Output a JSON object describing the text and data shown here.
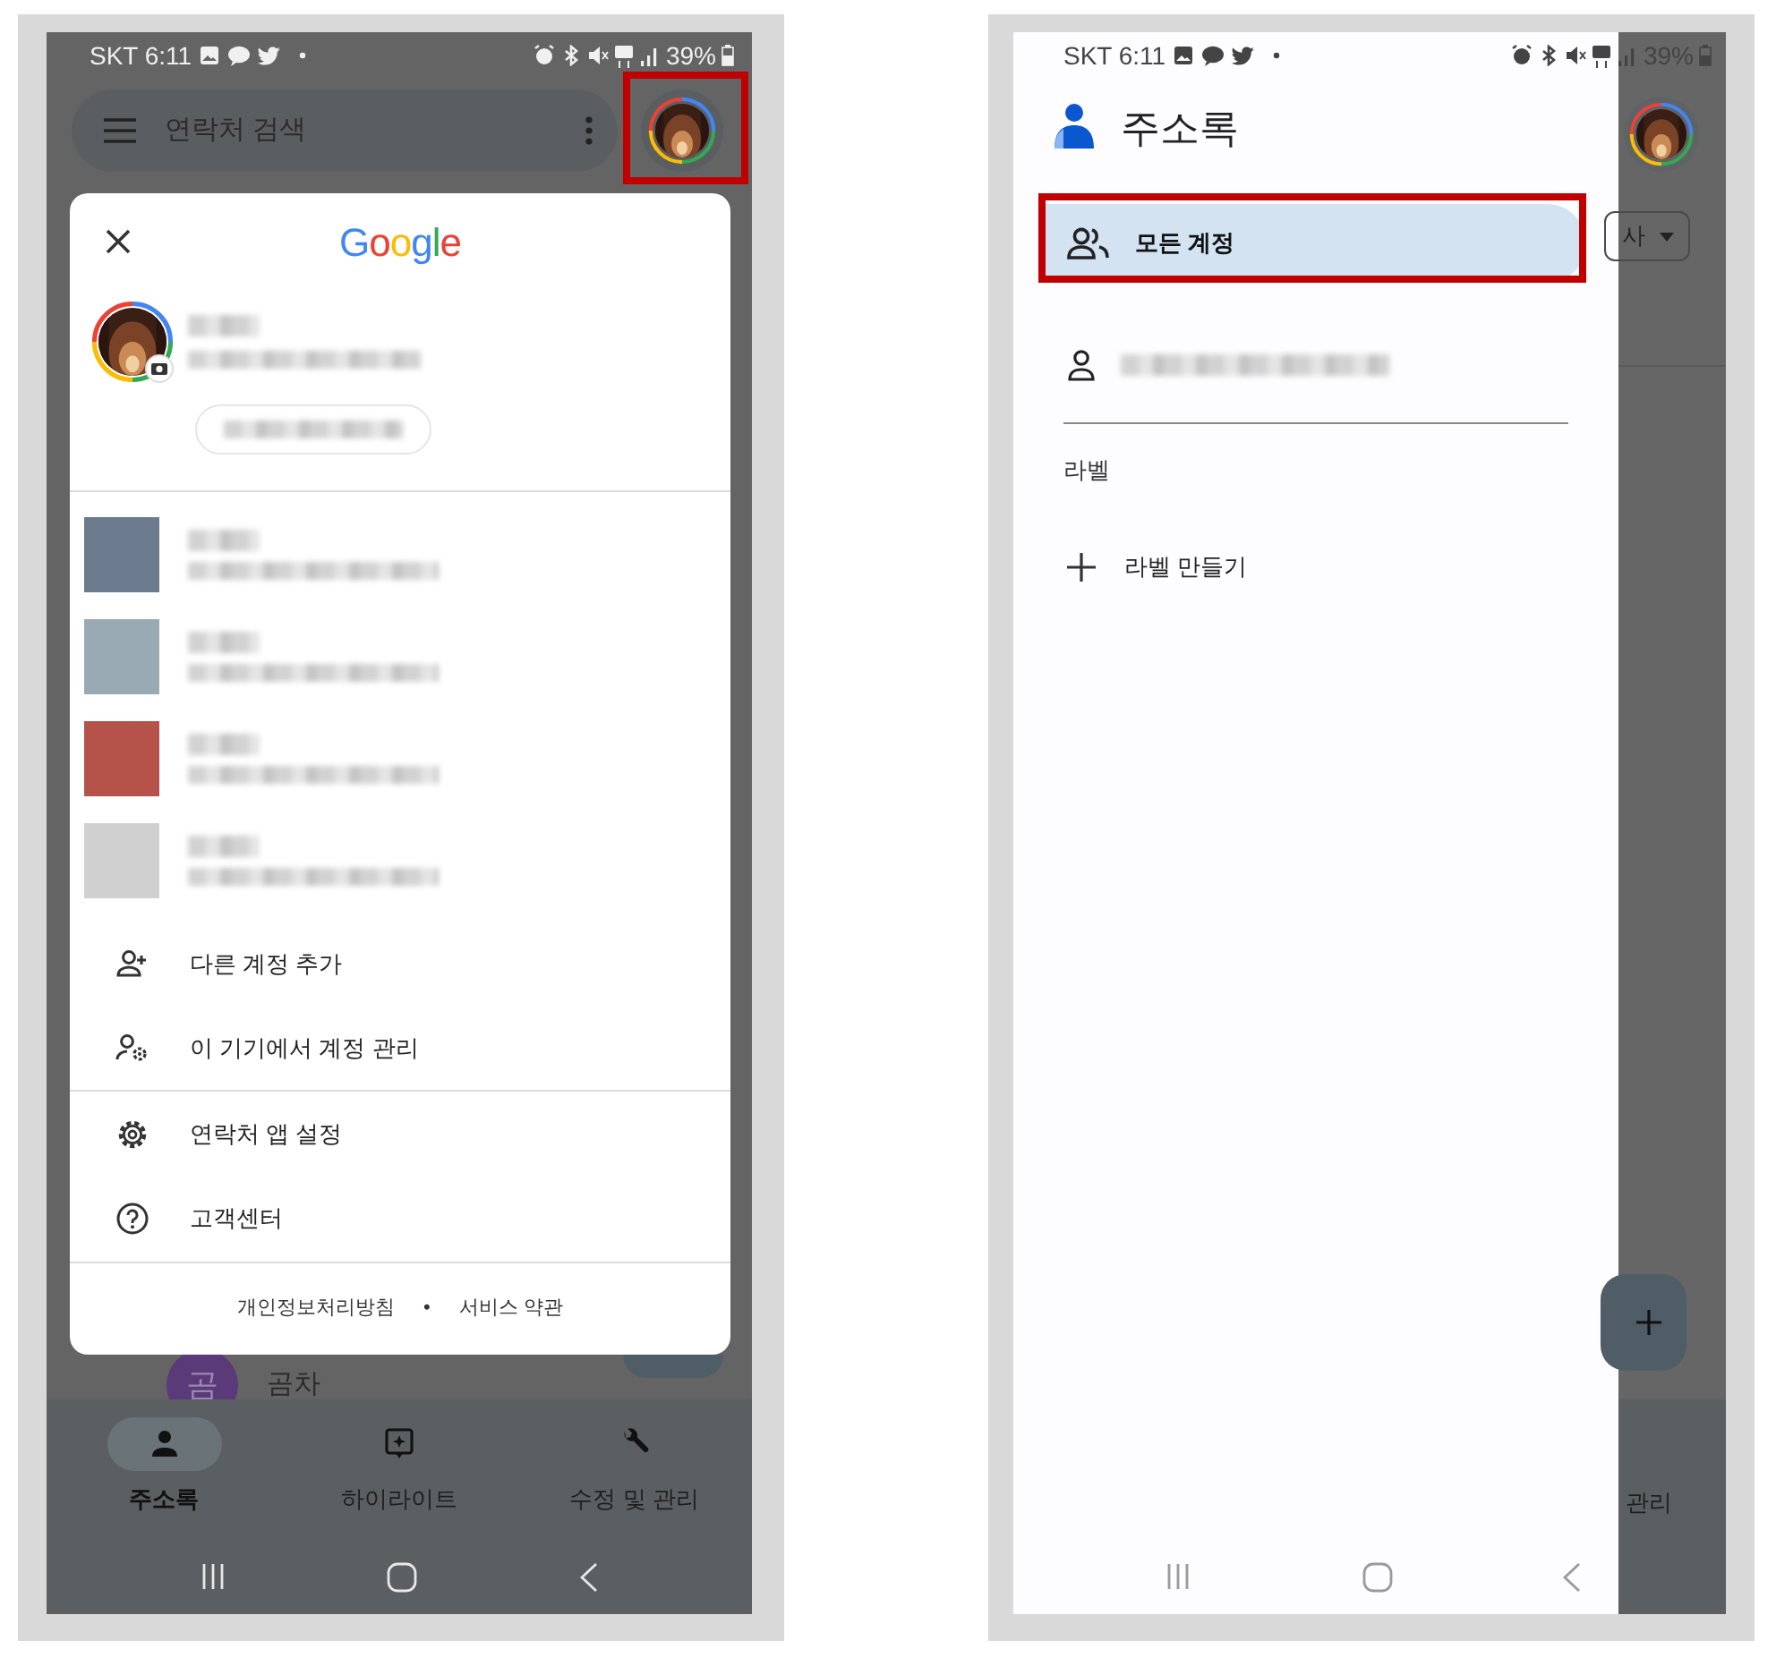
{
  "left_screen": {
    "status_bar": {
      "carrier_time": "SKT 6:11",
      "battery": "39%"
    },
    "search": {
      "placeholder": "연락처 검색"
    },
    "profile_button": {
      "highlighted": true
    },
    "account_card": {
      "logo": "Google",
      "other_accounts": [
        {
          "color": "#6b7a8c"
        },
        {
          "color": "#9aaab5"
        },
        {
          "color": "#b5524a"
        },
        {
          "color": "#d0d0d0"
        }
      ],
      "actions": [
        {
          "kind": "add-account",
          "label": "다른 계정 추가"
        },
        {
          "kind": "manage-accounts",
          "label": "이 기기에서 계정 관리"
        },
        {
          "kind": "settings",
          "label": "연락처 앱 설정",
          "divider_before": true
        },
        {
          "kind": "help",
          "label": "고객센터"
        }
      ],
      "links": [
        "개인정보처리방침",
        "서비스 약관"
      ],
      "link_separator": "•"
    },
    "contact_peek": {
      "initial": "곰",
      "name": "곰차"
    },
    "bottom_nav": [
      {
        "kind": "contacts",
        "label": "주소록",
        "selected": true
      },
      {
        "kind": "highlights",
        "label": "하이라이트",
        "selected": false
      },
      {
        "kind": "fix",
        "label": "수정 및 관리",
        "selected": false
      }
    ]
  },
  "right_screen": {
    "status_bar": {
      "carrier_time": "SKT 6:11",
      "battery": "39%"
    },
    "drawer": {
      "title": "주소록",
      "items": [
        {
          "kind": "all-accounts",
          "label": "모든 계정",
          "selected": true,
          "highlighted": true
        },
        {
          "kind": "account",
          "selected": false,
          "highlighted": false
        }
      ],
      "section_label": "라벨",
      "create_label": "라벨 만들기"
    },
    "behind": {
      "chip_text": "사",
      "nav_text": "관리"
    }
  }
}
